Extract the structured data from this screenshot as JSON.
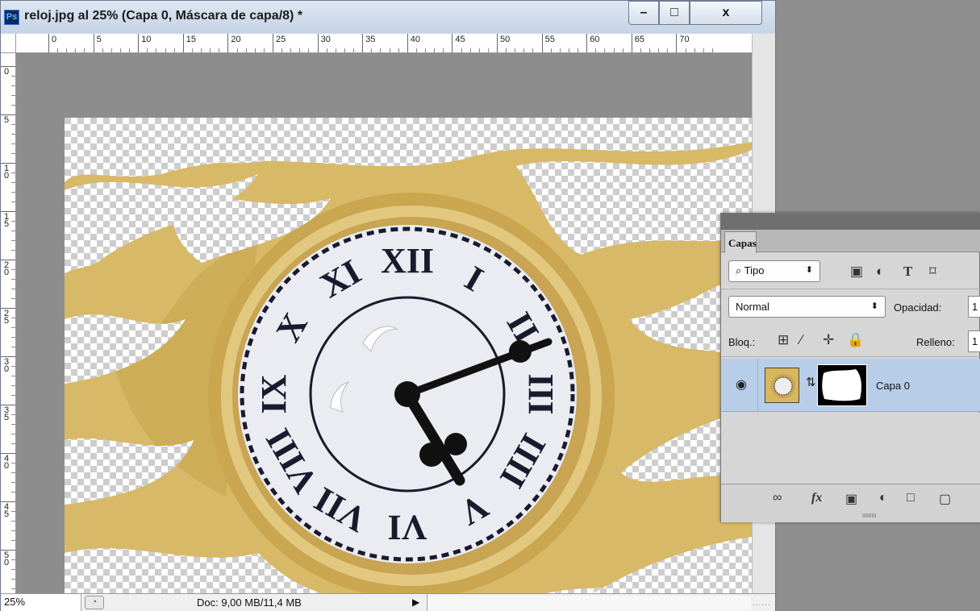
{
  "window": {
    "app_badge": "Ps",
    "title": "reloj.jpg al 25% (Capa 0, Máscara de capa/8) *",
    "minimize": "–",
    "maximize": "□",
    "close": "x"
  },
  "ruler_h_labels": [
    "0",
    "5",
    "10",
    "15",
    "20",
    "25",
    "30",
    "35",
    "40",
    "45",
    "50",
    "55",
    "60",
    "65",
    "70"
  ],
  "ruler_v_labels": [
    "0",
    "5",
    "1\n0",
    "1\n5",
    "2\n0",
    "2\n5",
    "3\n0",
    "3\n5",
    "4\n0",
    "4\n5",
    "5\n0"
  ],
  "statusbar": {
    "zoom": "25%",
    "doc_info": "Doc: 9,00 MB/11,4 MB",
    "arrow": "▶",
    "grip": "......"
  },
  "layers_panel": {
    "tab": "Capas",
    "filter_kind": "⌕ Tipo",
    "filter_arrow": "⬍",
    "blend_mode": "Normal",
    "blend_arrow": "⬍",
    "opacity_label": "Opacidad:",
    "opacity_value": "1",
    "lock_label": "Bloq.:",
    "fill_label": "Relleno:",
    "fill_value": "1",
    "layer_name": "Capa 0"
  },
  "icons": {
    "filter_image": "▣",
    "filter_adjust": "◐",
    "filter_type": "T",
    "filter_shape": "⌑",
    "lock_pixels": "⊞",
    "lock_paint": "∕",
    "lock_move": "✛",
    "lock_all": "☰",
    "eye": "◉",
    "link_chain": "⇅",
    "footer_link": "∞",
    "footer_fx": "fx",
    "footer_mask": "▣",
    "footer_adjust": "◐",
    "footer_group": "□",
    "footer_new": "▢"
  },
  "colors": {
    "titlebar": "#d3dceb",
    "selected_layer": "#b8cde8",
    "clock_frame": "#d7b967",
    "clock_face": "#e8e8ee",
    "numerals": "#1a1a2e"
  },
  "clock": {
    "numerals": [
      "XII",
      "I",
      "II",
      "III",
      "IIII",
      "V",
      "VI",
      "VII",
      "VIII",
      "IX",
      "X",
      "XI"
    ]
  }
}
